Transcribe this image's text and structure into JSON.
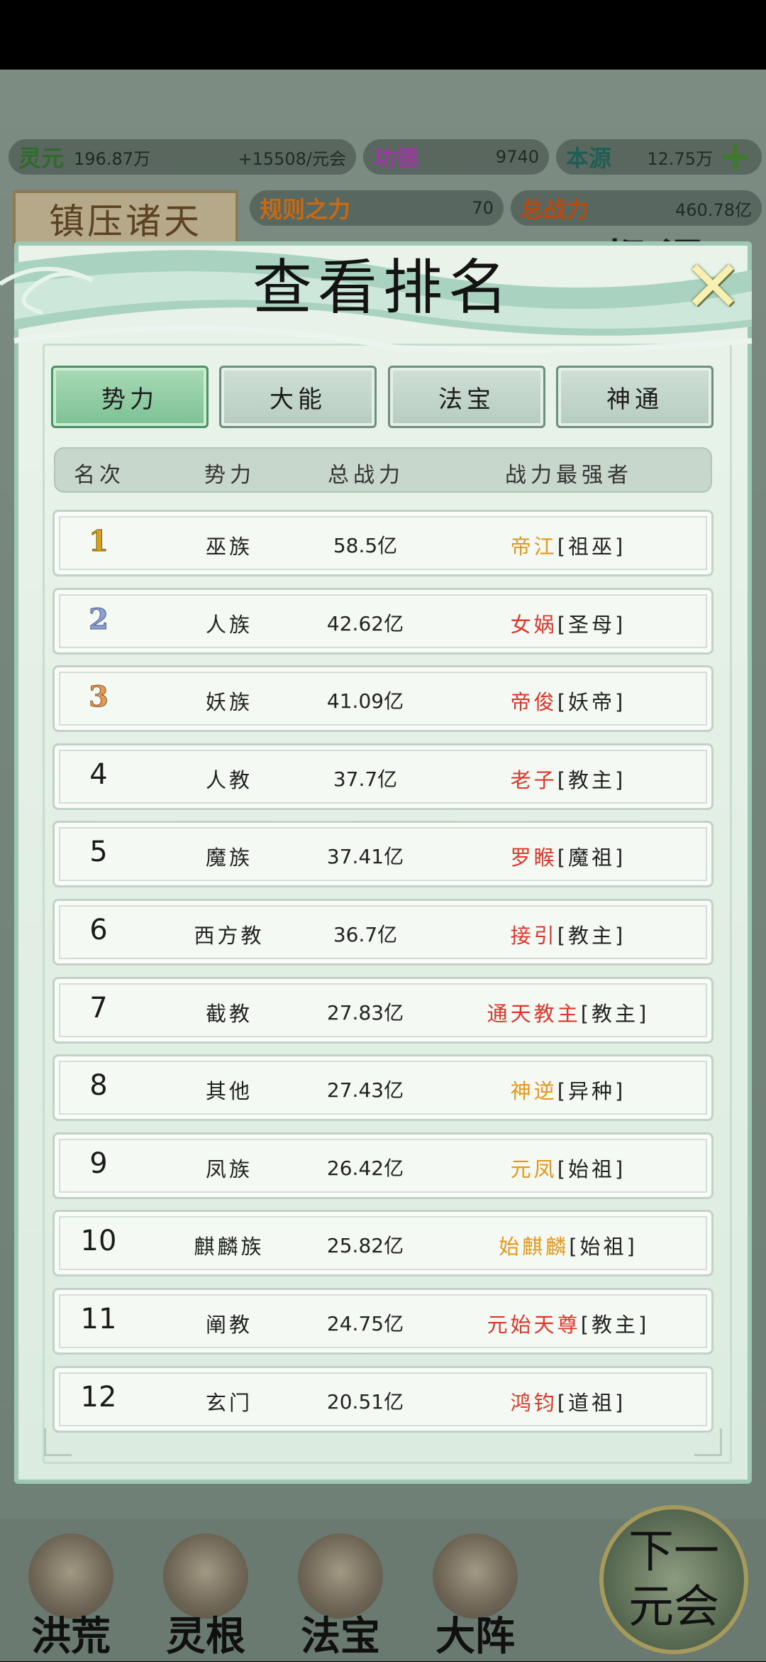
{
  "colors": {
    "orange": "#e8961a",
    "red": "#e0352b",
    "accent_tab": "#8fcfa2"
  },
  "resources": {
    "lingyuan": {
      "label": "灵元",
      "value": "196.87万",
      "rate": "+15508/元会",
      "label_color": "#2f6b2a"
    },
    "gongde": {
      "label": "功德",
      "value": "9740",
      "label_color": "#9a3aa0"
    },
    "benyuan": {
      "label": "本源",
      "value": "12.75万",
      "label_color": "#1e5e55"
    },
    "guize": {
      "label": "规则之力",
      "value": "70",
      "label_color": "#c76a12"
    },
    "zongzhanli": {
      "label": "总战力",
      "value": "460.78亿",
      "label_color": "#b54a12"
    }
  },
  "banner": "镇压诸天",
  "behind_text": "都 涩",
  "modal": {
    "title": "查看排名",
    "tabs": [
      {
        "label": "势力",
        "active": true
      },
      {
        "label": "大能",
        "active": false
      },
      {
        "label": "法宝",
        "active": false
      },
      {
        "label": "神通",
        "active": false
      }
    ],
    "columns": {
      "rank": "名次",
      "faction": "势力",
      "power": "总战力",
      "strongest": "战力最强者"
    },
    "rows": [
      {
        "rank": "1",
        "faction": "巫族",
        "power": "58.5亿",
        "name": "帝江",
        "title": "[祖巫]",
        "name_color": "orange"
      },
      {
        "rank": "2",
        "faction": "人族",
        "power": "42.62亿",
        "name": "女娲",
        "title": "[圣母]",
        "name_color": "red"
      },
      {
        "rank": "3",
        "faction": "妖族",
        "power": "41.09亿",
        "name": "帝俊",
        "title": "[妖帝]",
        "name_color": "red"
      },
      {
        "rank": "4",
        "faction": "人教",
        "power": "37.7亿",
        "name": "老子",
        "title": "[教主]",
        "name_color": "red"
      },
      {
        "rank": "5",
        "faction": "魔族",
        "power": "37.41亿",
        "name": "罗睺",
        "title": "[魔祖]",
        "name_color": "red"
      },
      {
        "rank": "6",
        "faction": "西方教",
        "power": "36.7亿",
        "name": "接引",
        "title": "[教主]",
        "name_color": "red"
      },
      {
        "rank": "7",
        "faction": "截教",
        "power": "27.83亿",
        "name": "通天教主",
        "title": "[教主]",
        "name_color": "red"
      },
      {
        "rank": "8",
        "faction": "其他",
        "power": "27.43亿",
        "name": "神逆",
        "title": "[异种]",
        "name_color": "orange"
      },
      {
        "rank": "9",
        "faction": "凤族",
        "power": "26.42亿",
        "name": "元凤",
        "title": "[始祖]",
        "name_color": "orange"
      },
      {
        "rank": "10",
        "faction": "麒麟族",
        "power": "25.82亿",
        "name": "始麒麟",
        "title": "[始祖]",
        "name_color": "orange"
      },
      {
        "rank": "11",
        "faction": "阐教",
        "power": "24.75亿",
        "name": "元始天尊",
        "title": "[教主]",
        "name_color": "red"
      },
      {
        "rank": "12",
        "faction": "玄门",
        "power": "20.51亿",
        "name": "鸿钧",
        "title": "[道祖]",
        "name_color": "red"
      }
    ]
  },
  "nav": {
    "items": [
      {
        "label": "洪荒",
        "icon": "mountain-flame-icon"
      },
      {
        "label": "灵根",
        "icon": "lotus-icon"
      },
      {
        "label": "法宝",
        "icon": "treasure-orb-icon"
      },
      {
        "label": "大阵",
        "icon": "taiji-formation-icon"
      }
    ],
    "next_line1": "下一",
    "next_line2": "元会"
  }
}
